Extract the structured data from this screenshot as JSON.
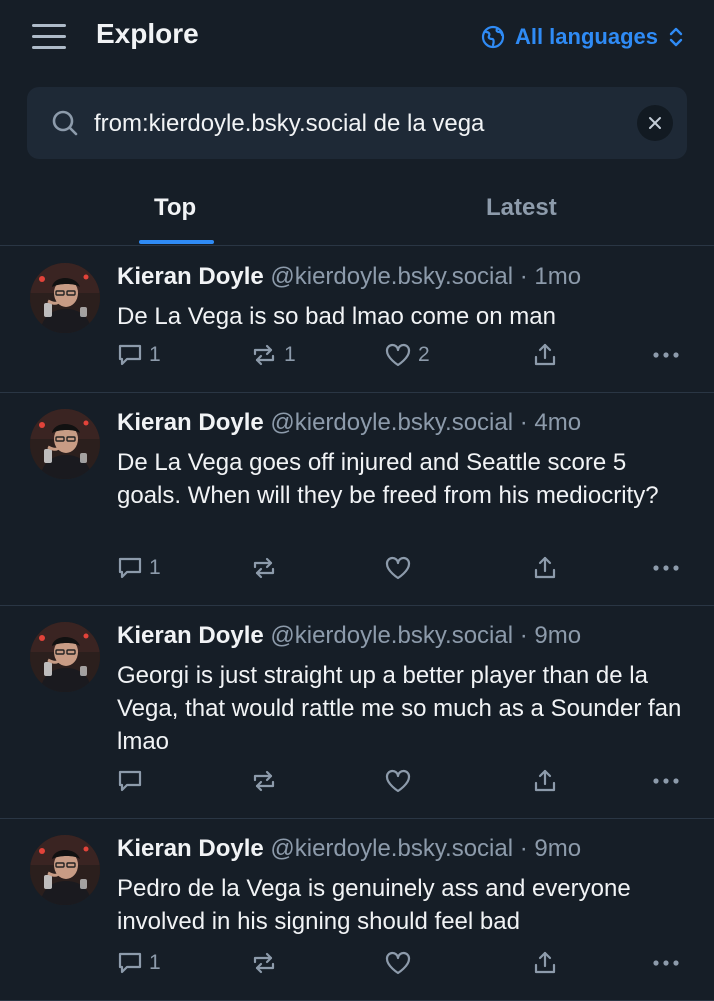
{
  "header": {
    "title": "Explore",
    "language_label": "All languages",
    "menu_icon": "hamburger-menu-icon",
    "language_icon": "globe-icon",
    "chevron_icon": "up-down-chevron-icon"
  },
  "search": {
    "value": "from:kierdoyle.bsky.social de la vega",
    "placeholder": ""
  },
  "tabs": [
    {
      "label": "Top",
      "active": true
    },
    {
      "label": "Latest",
      "active": false
    }
  ],
  "colors": {
    "background": "#161e27",
    "accent": "#2f8bf5",
    "muted_text": "#8d9bab",
    "search_bg": "#1e2936"
  },
  "posts": [
    {
      "author": "Kieran Doyle",
      "handle": "@kierdoyle.bsky.social",
      "time": "1mo",
      "text": "De La Vega is so bad lmao come on man",
      "replies": "1",
      "reposts": "1",
      "likes": "2"
    },
    {
      "author": "Kieran Doyle",
      "handle": "@kierdoyle.bsky.social",
      "time": "4mo",
      "text": "De La Vega goes off injured and Seattle score 5 goals. When will they be freed from his mediocrity?",
      "replies": "1",
      "reposts": "",
      "likes": ""
    },
    {
      "author": "Kieran Doyle",
      "handle": "@kierdoyle.bsky.social",
      "time": "9mo",
      "text": "Georgi is just straight up a better player than de la Vega, that would rattle me so much as a Sounder fan lmao",
      "replies": "",
      "reposts": "",
      "likes": ""
    },
    {
      "author": "Kieran Doyle",
      "handle": "@kierdoyle.bsky.social",
      "time": "9mo",
      "text": "Pedro de la Vega is genuinely ass and everyone involved in his signing should feel bad",
      "replies": "1",
      "reposts": "",
      "likes": ""
    }
  ]
}
